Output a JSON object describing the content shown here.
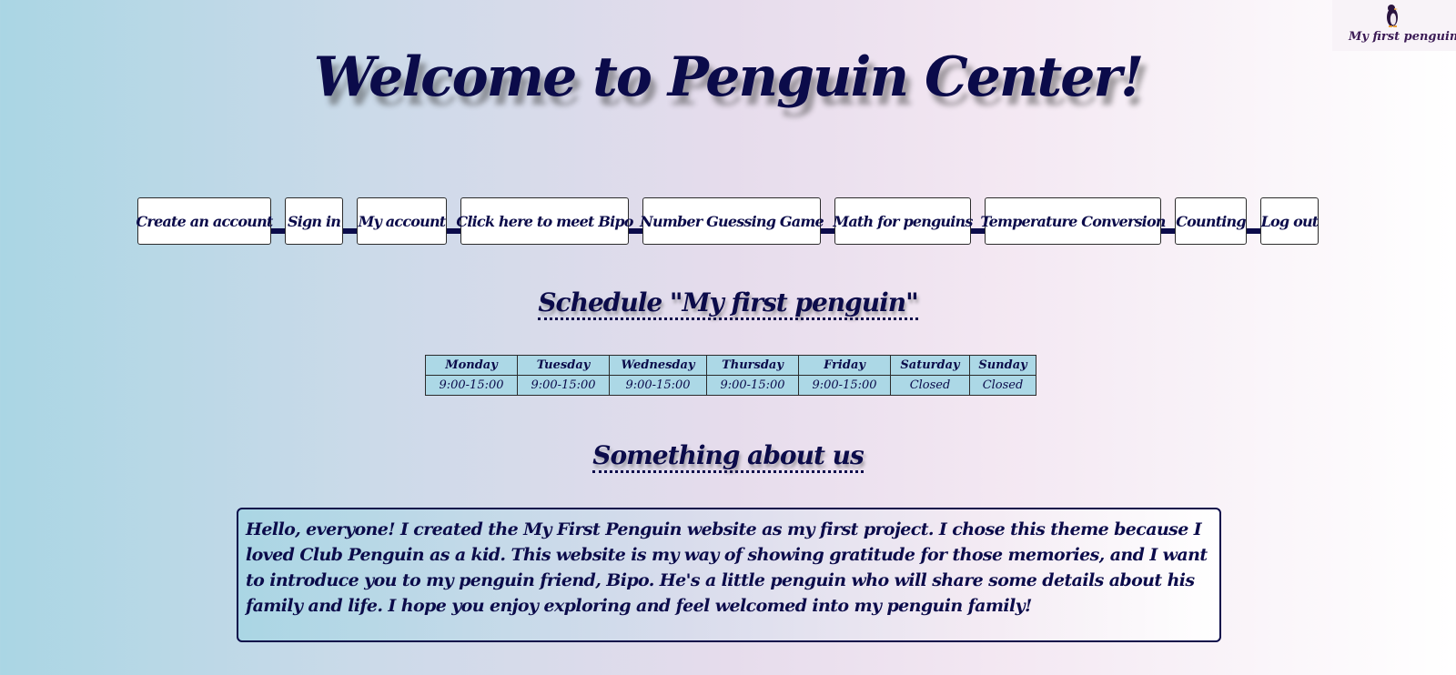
{
  "logo": {
    "text": "My first penguin",
    "icon": "penguin-icon"
  },
  "title": "Welcome to Penguin Center!",
  "nav": {
    "items": [
      "Create an account",
      "Sign in",
      "My account",
      "Click here to meet Bipo",
      "Number Guessing Game",
      "Math for penguins",
      "Temperature Conversion",
      "Counting",
      "Log out"
    ]
  },
  "schedule": {
    "heading": "Schedule \"My first penguin\"",
    "days": [
      "Monday",
      "Tuesday",
      "Wednesday",
      "Thursday",
      "Friday",
      "Saturday",
      "Sunday"
    ],
    "hours": [
      "9:00-15:00",
      "9:00-15:00",
      "9:00-15:00",
      "9:00-15:00",
      "9:00-15:00",
      "Closed",
      "Closed"
    ]
  },
  "about": {
    "heading": "Something about us",
    "text": "Hello, everyone! I created the My First Penguin website as my first project. I chose this theme because I loved Club Penguin as a kid. This website is my way of showing gratitude for those memories, and I want to introduce you to my penguin friend, Bipo. He's a little penguin who will share some details about his family and life. I hope you enjoy exploring and feel welcomed into my penguin family!"
  },
  "colors": {
    "text": "#0b0b4a",
    "table_bg": "#acd8e6",
    "gradient_start": "#aad6e4",
    "gradient_end": "#ffffff"
  }
}
